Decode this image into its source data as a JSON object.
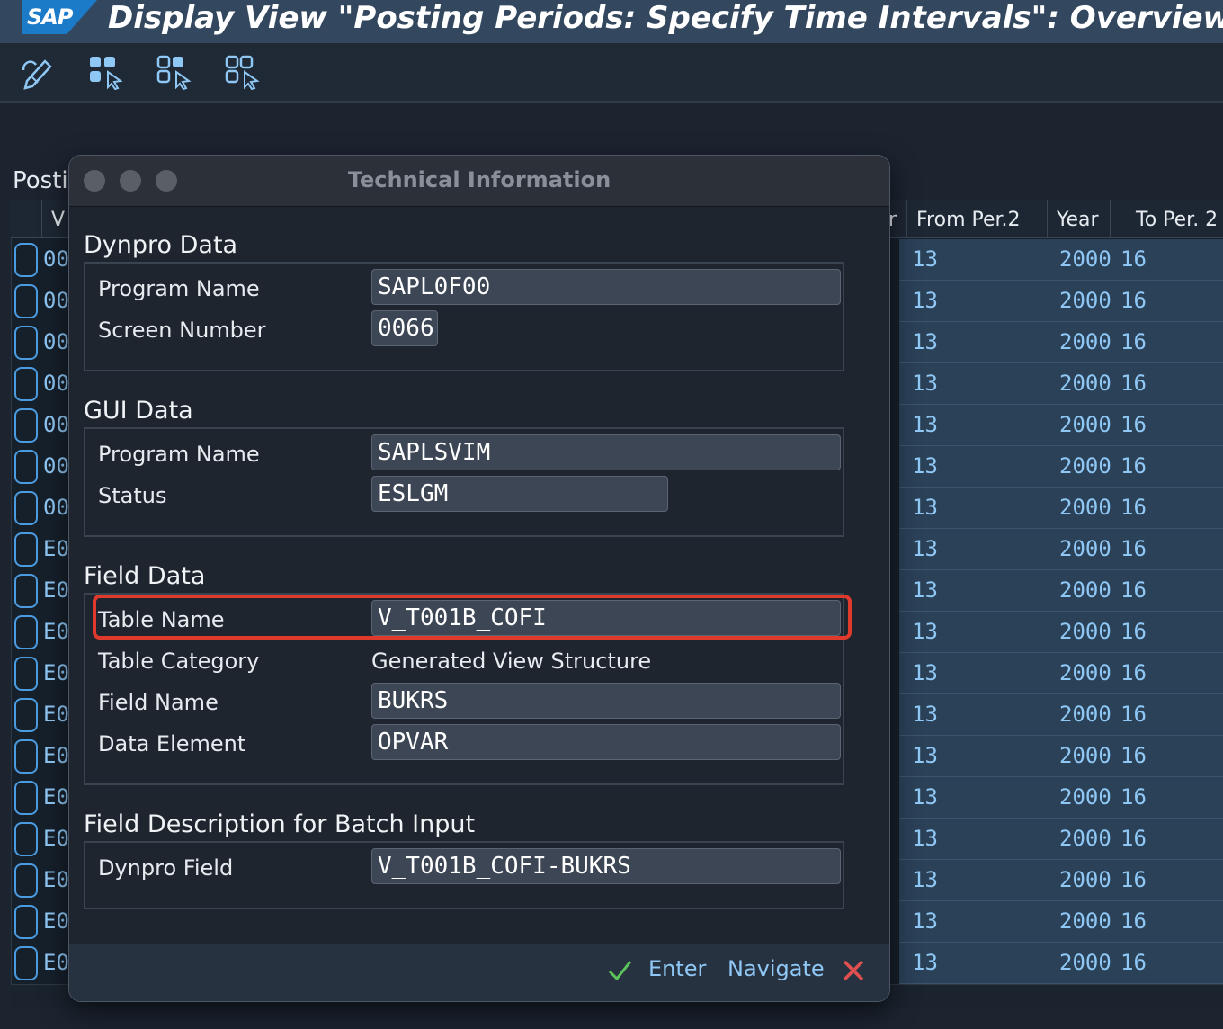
{
  "window": {
    "brand": "SAP",
    "title": "Display View \"Posting Periods: Specify Time Intervals\": Overview"
  },
  "toolbar": {
    "buttons": [
      "edit-icon",
      "select-all-icon",
      "select-block-icon",
      "deselect-all-icon"
    ]
  },
  "background_screen": {
    "section_title_partial": "Posti",
    "columns": {
      "partial_left": "V",
      "partial_right": "r",
      "from_per2": "From Per.2",
      "year": "Year",
      "to_per2_partial": "To Per. 2"
    },
    "rows": [
      {
        "key": "00",
        "from": "13",
        "year": "2000",
        "to": "16"
      },
      {
        "key": "00",
        "from": "13",
        "year": "2000",
        "to": "16"
      },
      {
        "key": "00",
        "from": "13",
        "year": "2000",
        "to": "16"
      },
      {
        "key": "00",
        "from": "13",
        "year": "2000",
        "to": "16"
      },
      {
        "key": "00",
        "from": "13",
        "year": "2000",
        "to": "16"
      },
      {
        "key": "00",
        "from": "13",
        "year": "2000",
        "to": "16"
      },
      {
        "key": "00",
        "from": "13",
        "year": "2000",
        "to": "16"
      },
      {
        "key": "E0",
        "from": "13",
        "year": "2000",
        "to": "16"
      },
      {
        "key": "E0",
        "from": "13",
        "year": "2000",
        "to": "16"
      },
      {
        "key": "E0",
        "from": "13",
        "year": "2000",
        "to": "16"
      },
      {
        "key": "E0",
        "from": "13",
        "year": "2000",
        "to": "16"
      },
      {
        "key": "E0",
        "from": "13",
        "year": "2000",
        "to": "16"
      },
      {
        "key": "E0",
        "from": "13",
        "year": "2000",
        "to": "16"
      },
      {
        "key": "E0",
        "from": "13",
        "year": "2000",
        "to": "16"
      },
      {
        "key": "E0",
        "from": "13",
        "year": "2000",
        "to": "16"
      },
      {
        "key": "E0",
        "from": "13",
        "year": "2000",
        "to": "16"
      },
      {
        "key": "E0",
        "from": "13",
        "year": "2000",
        "to": "16"
      },
      {
        "key": "E0",
        "from": "13",
        "year": "2000",
        "to": "16"
      }
    ]
  },
  "dialog": {
    "title": "Technical Information",
    "dynpro": {
      "heading": "Dynpro Data",
      "program_label": "Program Name",
      "program_value": "SAPL0F00",
      "screen_label": "Screen Number",
      "screen_value": "0066"
    },
    "gui": {
      "heading": "GUI Data",
      "program_label": "Program Name",
      "program_value": "SAPLSVIM",
      "status_label": "Status",
      "status_value": "ESLGM"
    },
    "field": {
      "heading": "Field Data",
      "table_label": "Table Name",
      "table_value": "V_T001B_COFI",
      "category_label": "Table Category",
      "category_value": "Generated View Structure",
      "field_label": "Field Name",
      "field_value": "BUKRS",
      "element_label": "Data Element",
      "element_value": "OPVAR"
    },
    "batch": {
      "heading": "Field Description for Batch Input",
      "dynpro_field_label": "Dynpro Field",
      "dynpro_field_value": "V_T001B_COFI-BUKRS"
    },
    "footer": {
      "enter_label": "Enter",
      "navigate_label": "Navigate"
    }
  },
  "colors": {
    "accent": "#8fc7f5",
    "highlight": "#e03a2c",
    "confirm": "#5cc25c",
    "cancel": "#e05050"
  }
}
